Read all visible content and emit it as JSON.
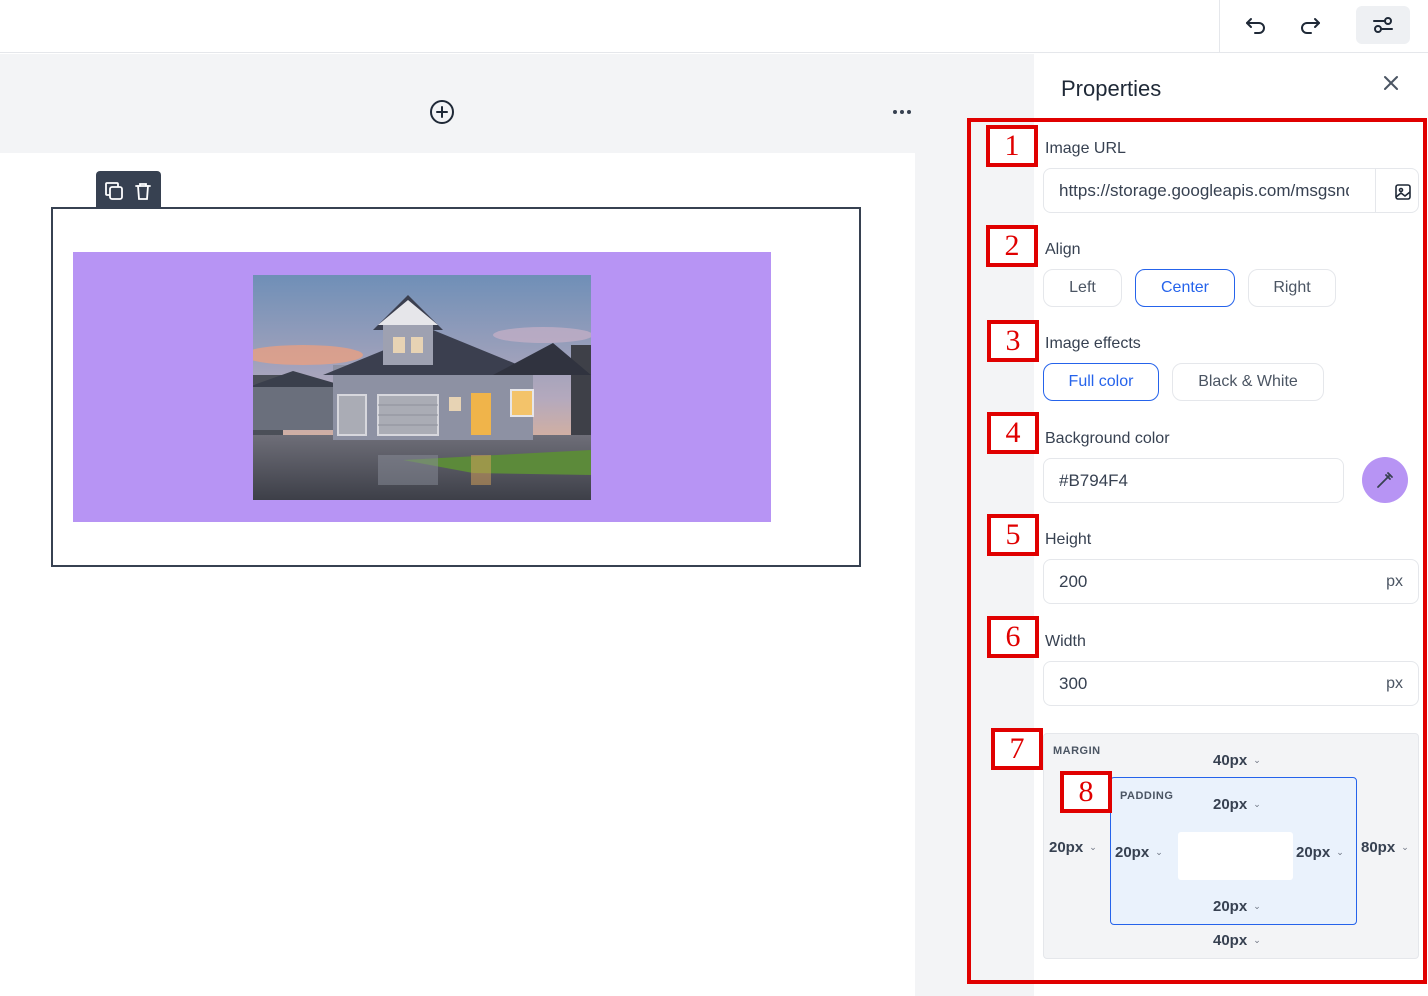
{
  "toolbar": {
    "undo_icon": "undo-icon",
    "redo_icon": "redo-icon",
    "settings_icon": "settings-sliders-icon"
  },
  "canvas": {
    "add_icon": "plus-circle-icon",
    "more_icon": "more-horizontal-icon",
    "block_tools": [
      "copy-icon",
      "trash-icon"
    ],
    "image_background_color": "#B794F4"
  },
  "properties": {
    "title": "Properties",
    "markers": [
      "1",
      "2",
      "3",
      "4",
      "5",
      "6",
      "7",
      "8"
    ],
    "image_url": {
      "label": "Image URL",
      "value": "https://storage.googleapis.com/msgsndr/image.jpg"
    },
    "align": {
      "label": "Align",
      "options": [
        "Left",
        "Center",
        "Right"
      ],
      "selected": "Center"
    },
    "effects": {
      "label": "Image effects",
      "options": [
        "Full color",
        "Black & White"
      ],
      "selected": "Full color"
    },
    "background": {
      "label": "Background color",
      "value": "#B794F4"
    },
    "height": {
      "label": "Height",
      "value": "200",
      "unit": "px"
    },
    "width": {
      "label": "Width",
      "value": "300",
      "unit": "px"
    },
    "spacing": {
      "margin_label": "MARGIN",
      "padding_label": "PADDING",
      "margin_top": "40px",
      "margin_right": "80px",
      "margin_bottom": "40px",
      "margin_left": "20px",
      "padding_top": "20px",
      "padding_right": "20px",
      "padding_bottom": "20px",
      "padding_left": "20px"
    }
  }
}
